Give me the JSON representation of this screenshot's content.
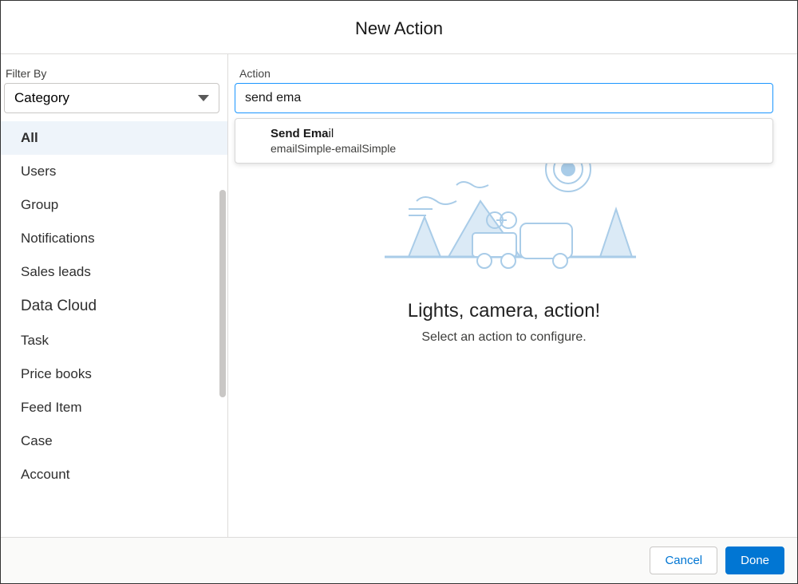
{
  "header": {
    "title": "New Action"
  },
  "sidebar": {
    "filter_label": "Filter By",
    "select_value": "Category",
    "items": [
      {
        "label": "All",
        "selected": true
      },
      {
        "label": "Users"
      },
      {
        "label": "Group"
      },
      {
        "label": "Notifications"
      },
      {
        "label": "Sales leads"
      },
      {
        "label": "Data Cloud"
      },
      {
        "label": "Task"
      },
      {
        "label": "Price books"
      },
      {
        "label": "Feed Item"
      },
      {
        "label": "Case"
      },
      {
        "label": "Account"
      }
    ]
  },
  "main": {
    "action_label": "Action",
    "input_value": "send ema",
    "autocomplete": {
      "match_bold": "Send Ema",
      "match_rest": "il",
      "subtitle": "emailSimple-emailSimple"
    },
    "prompt_title": "Lights, camera, action!",
    "prompt_sub": "Select an action to configure."
  },
  "footer": {
    "cancel": "Cancel",
    "done": "Done"
  },
  "colors": {
    "brand": "#0176d3",
    "illus_stroke": "#a9cce8",
    "illus_fill": "#dbeaf6"
  }
}
